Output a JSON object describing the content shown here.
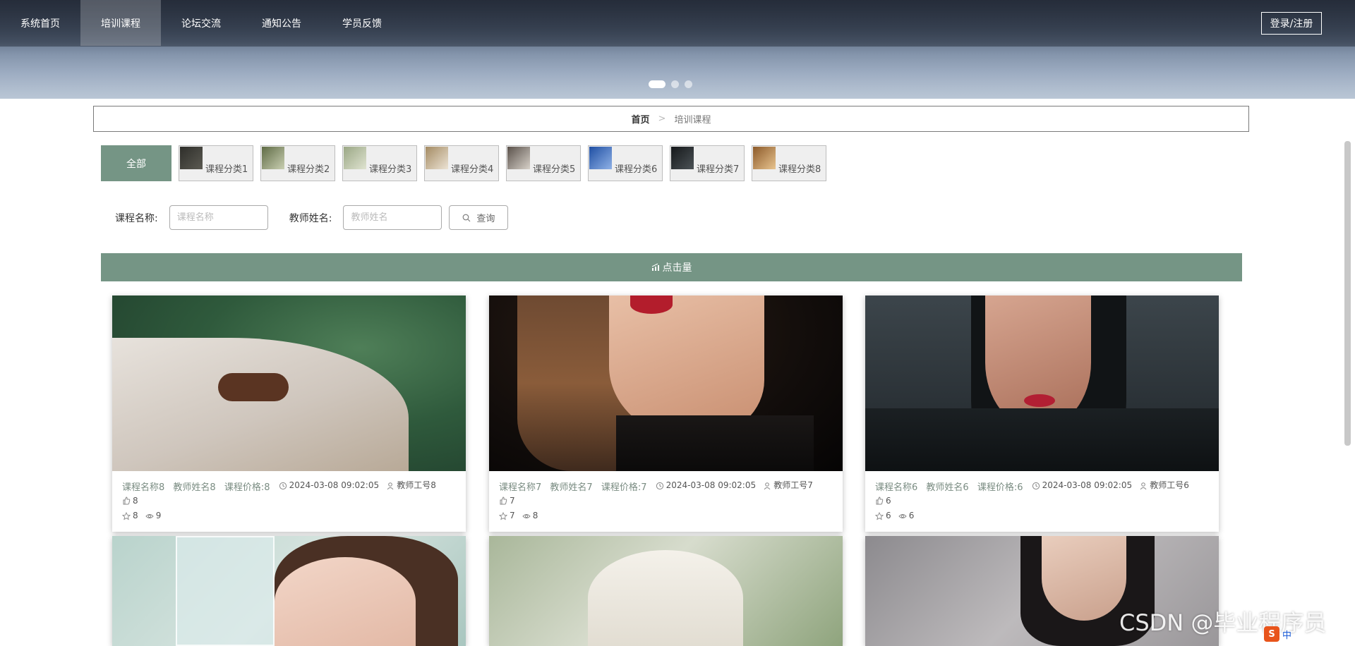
{
  "nav": {
    "items": [
      {
        "label": "系统首页"
      },
      {
        "label": "培训课程"
      },
      {
        "label": "论坛交流"
      },
      {
        "label": "通知公告"
      },
      {
        "label": "学员反馈"
      }
    ],
    "login_label": "登录/注册"
  },
  "carousel": {
    "dots": 3,
    "active": 1
  },
  "breadcrumb": {
    "home": "首页",
    "separator": ">",
    "current": "培训课程"
  },
  "categories": {
    "all_label": "全部",
    "items": [
      {
        "label": "课程分类1",
        "thumb_color": "#2e2e2a"
      },
      {
        "label": "课程分类2",
        "thumb_color": "#8f9a6e"
      },
      {
        "label": "课程分类3",
        "thumb_color": "#b8c2a0"
      },
      {
        "label": "课程分类4",
        "thumb_color": "#c9b79a"
      },
      {
        "label": "课程分类5",
        "thumb_color": "#7d7268"
      },
      {
        "label": "课程分类6",
        "thumb_color": "#3a6bb8"
      },
      {
        "label": "课程分类7",
        "thumb_color": "#222628"
      },
      {
        "label": "课程分类8",
        "thumb_color": "#c4955a"
      }
    ]
  },
  "search": {
    "course_label": "课程名称:",
    "course_placeholder": "课程名称",
    "teacher_label": "教师姓名:",
    "teacher_placeholder": "教师姓名",
    "query_label": "查询"
  },
  "section": {
    "title": "点击量"
  },
  "cards": [
    {
      "name": "课程名称8",
      "teacher": "教师姓名8",
      "price": "课程价格:8",
      "time": "2024-03-08 09:02:05",
      "teacher_no": "教师工号8",
      "likes": "8",
      "favorites": "8",
      "views": "9",
      "photo_colors": [
        "#3f6e4a",
        "#9fb39a",
        "#d9cfc2"
      ]
    },
    {
      "name": "课程名称7",
      "teacher": "教师姓名7",
      "price": "课程价格:7",
      "time": "2024-03-08 09:02:05",
      "teacher_no": "教师工号7",
      "likes": "7",
      "favorites": "7",
      "views": "8",
      "photo_colors": [
        "#120d0b",
        "#6e4a32",
        "#d8a78b"
      ]
    },
    {
      "name": "课程名称6",
      "teacher": "教师姓名6",
      "price": "课程价格:6",
      "time": "2024-03-08 09:02:05",
      "teacher_no": "教师工号6",
      "likes": "6",
      "favorites": "6",
      "views": "6",
      "photo_colors": [
        "#2c3338",
        "#4b555c",
        "#c48e78"
      ]
    },
    {
      "photo_colors": [
        "#b9d3cc",
        "#d6e4df",
        "#e7c7b8"
      ]
    },
    {
      "photo_colors": [
        "#a9b79a",
        "#d7dccd",
        "#f0ede6"
      ]
    },
    {
      "photo_colors": [
        "#8c8a8e",
        "#bdbabc",
        "#3a3032"
      ]
    }
  ],
  "watermark": "CSDN @毕业程序员",
  "ime": {
    "label": "中"
  }
}
